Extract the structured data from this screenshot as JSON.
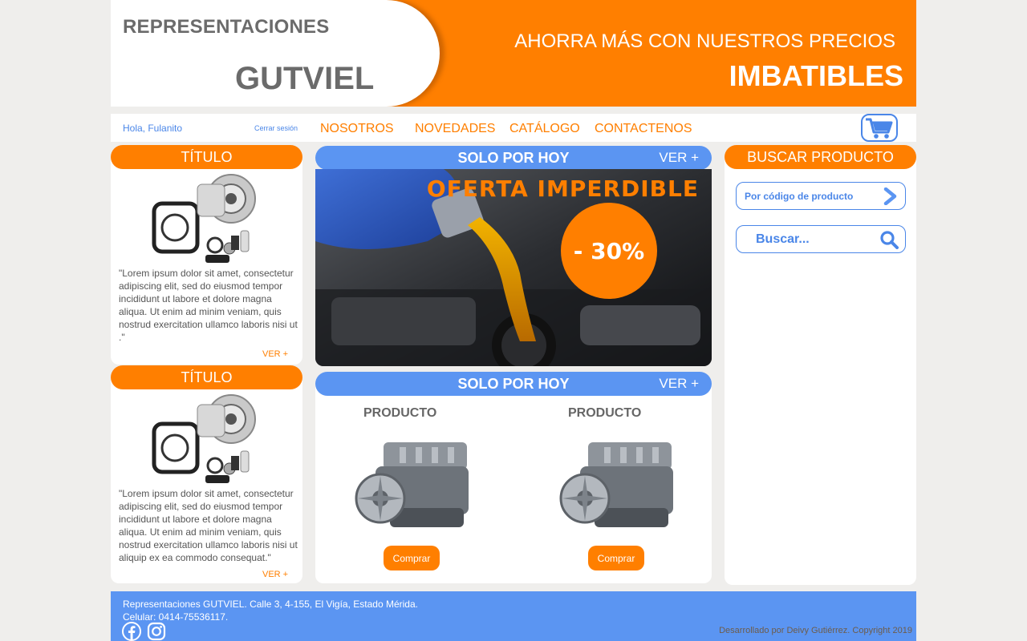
{
  "header": {
    "logo_top": "REPRESENTACIONES",
    "logo_main": "GUTVIEL",
    "tagline_top": "AHORRA MÁS CON NUESTROS PRECIOS",
    "tagline_main": "IMBATIBLES",
    "colors": {
      "brand_orange": "#ff7f00",
      "text_gray": "#6b6b6b"
    }
  },
  "nav": {
    "greeting": "Hola, Fulanito",
    "logout": "Cerrar sesión",
    "items": [
      "NOSOTROS",
      "NOVEDADES",
      "CATÁLOGO",
      "CONTACTENOS"
    ],
    "cart_icon": "shopping-cart-icon"
  },
  "left_cards": [
    {
      "title": "TÍTULO",
      "image": "turbocharger-kit-image",
      "text": "\"Lorem ipsum dolor sit amet, consectetur adipiscing elit, sed do eiusmod tempor incididunt ut labore et dolore magna aliqua. Ut enim ad minim veniam, quis nostrud exercitation ullamco laboris nisi ut .\"",
      "more": "VER +"
    },
    {
      "title": "TÍTULO",
      "image": "turbocharger-kit-image",
      "text": "\"Lorem ipsum dolor sit amet, consectetur adipiscing elit, sed do eiusmod tempor incididunt ut labore et dolore magna aliqua. Ut enim ad minim veniam, quis nostrud exercitation ullamco laboris nisi ut aliquip ex ea commodo consequat.\"",
      "more": "VER +"
    }
  ],
  "promo": {
    "header": "SOLO POR HOY",
    "more": "VER +",
    "title": "OFERTA IMPERDIBLE",
    "discount": "- 30%",
    "image": "motor-oil-pouring-image"
  },
  "products_section": {
    "header": "SOLO POR HOY",
    "more": "VER +",
    "products": [
      {
        "name": "PRODUCTO",
        "image": "engine-block-image",
        "button": "Comprar"
      },
      {
        "name": "PRODUCTO",
        "image": "engine-block-image",
        "button": "Comprar"
      }
    ]
  },
  "search": {
    "header": "BUSCAR PRODUCTO",
    "code_label": "Por código de producto",
    "placeholder": "Buscar...",
    "icons": [
      "chevron-right-icon",
      "search-icon"
    ],
    "accent": "#4a86e8"
  },
  "footer": {
    "address": "Representaciones GUTVIEL.  Calle 3, 4-155, El Vigía, Estado Mérida.",
    "phone": "Celular: 0414-75536117.",
    "copyright": "Desarrollado por Deivy Gutiérrez. Copyright 2019",
    "social_icons": [
      "facebook-icon",
      "instagram-icon"
    ],
    "bg": "#5b95f2"
  }
}
